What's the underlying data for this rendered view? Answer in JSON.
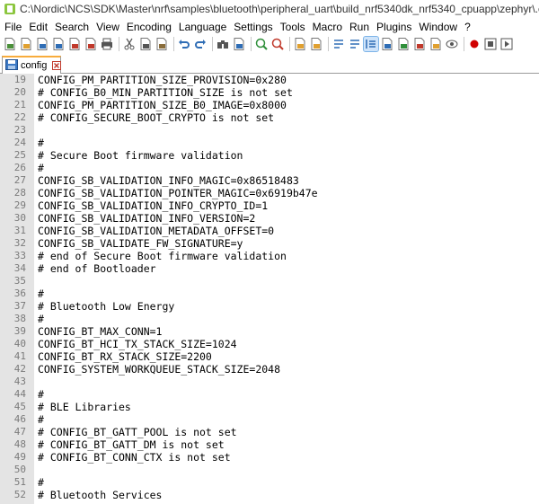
{
  "window": {
    "title": "C:\\Nordic\\NCS\\SDK\\Master\\nrf\\samples\\bluetooth\\peripheral_uart\\build_nrf5340dk_nrf5340_cpuapp\\zephyr\\.config -"
  },
  "menu": [
    {
      "name": "menu-file",
      "label": "File"
    },
    {
      "name": "menu-edit",
      "label": "Edit"
    },
    {
      "name": "menu-search",
      "label": "Search"
    },
    {
      "name": "menu-view",
      "label": "View"
    },
    {
      "name": "menu-encoding",
      "label": "Encoding"
    },
    {
      "name": "menu-language",
      "label": "Language"
    },
    {
      "name": "menu-settings",
      "label": "Settings"
    },
    {
      "name": "menu-tools",
      "label": "Tools"
    },
    {
      "name": "menu-macro",
      "label": "Macro"
    },
    {
      "name": "menu-run",
      "label": "Run"
    },
    {
      "name": "menu-plugins",
      "label": "Plugins"
    },
    {
      "name": "menu-window",
      "label": "Window"
    },
    {
      "name": "menu-help",
      "label": "?"
    }
  ],
  "toolbar": [
    {
      "name": "new-file-icon",
      "color": "#4a8f3a"
    },
    {
      "name": "open-file-icon",
      "color": "#e0a030"
    },
    {
      "name": "save-icon",
      "color": "#2f6db5"
    },
    {
      "name": "save-all-icon",
      "color": "#2f6db5"
    },
    {
      "name": "close-file-icon",
      "color": "#c0392b"
    },
    {
      "name": "close-all-icon",
      "color": "#c0392b"
    },
    {
      "name": "print-icon",
      "color": "#555555"
    },
    {
      "sep": true
    },
    {
      "name": "cut-icon",
      "color": "#555555"
    },
    {
      "name": "copy-icon",
      "color": "#555555"
    },
    {
      "name": "paste-icon",
      "color": "#8a6d3b"
    },
    {
      "sep": true
    },
    {
      "name": "undo-icon",
      "color": "#2f6db5"
    },
    {
      "name": "redo-icon",
      "color": "#2f6db5"
    },
    {
      "sep": true
    },
    {
      "name": "find-icon",
      "color": "#555555"
    },
    {
      "name": "replace-icon",
      "color": "#2f6db5"
    },
    {
      "sep": true
    },
    {
      "name": "zoom-in-icon",
      "color": "#2f8f3a"
    },
    {
      "name": "zoom-out-icon",
      "color": "#c0392b"
    },
    {
      "sep": true
    },
    {
      "name": "sync-vertical-icon",
      "color": "#e0a030"
    },
    {
      "name": "sync-horizontal-icon",
      "color": "#e0a030"
    },
    {
      "sep": true
    },
    {
      "name": "word-wrap-icon",
      "color": "#2f6db5"
    },
    {
      "name": "show-all-chars-icon",
      "color": "#2f6db5"
    },
    {
      "name": "indent-guide-icon",
      "color": "#2f6db5",
      "active": true
    },
    {
      "name": "user-language-icon",
      "color": "#2f6db5"
    },
    {
      "name": "document-map-icon",
      "color": "#2f8f3a"
    },
    {
      "name": "function-list-icon",
      "color": "#c0392b"
    },
    {
      "name": "folder-workspace-icon",
      "color": "#e0a030"
    },
    {
      "name": "monitoring-icon",
      "color": "#555555"
    },
    {
      "sep": true
    },
    {
      "name": "record-macro-icon",
      "color": "#d00000"
    },
    {
      "name": "stop-macro-icon",
      "color": "#555555"
    },
    {
      "name": "play-macro-icon",
      "color": "#555555"
    }
  ],
  "tab": {
    "label": "config",
    "color": "#f8ac3c"
  },
  "lines": [
    {
      "n": "19",
      "text": "CONFIG_PM_PARTITION_SIZE_PROVISION=0x280"
    },
    {
      "n": "20",
      "text": "# CONFIG_B0_MIN_PARTITION_SIZE is not set"
    },
    {
      "n": "21",
      "text": "CONFIG_PM_PARTITION_SIZE_B0_IMAGE=0x8000"
    },
    {
      "n": "22",
      "text": "# CONFIG_SECURE_BOOT_CRYPTO is not set"
    },
    {
      "n": "23",
      "text": ""
    },
    {
      "n": "24",
      "text": "#"
    },
    {
      "n": "25",
      "text": "# Secure Boot firmware validation"
    },
    {
      "n": "26",
      "text": "#"
    },
    {
      "n": "27",
      "text": "CONFIG_SB_VALIDATION_INFO_MAGIC=0x86518483"
    },
    {
      "n": "28",
      "text": "CONFIG_SB_VALIDATION_POINTER_MAGIC=0x6919b47e"
    },
    {
      "n": "29",
      "text": "CONFIG_SB_VALIDATION_INFO_CRYPTO_ID=1"
    },
    {
      "n": "30",
      "text": "CONFIG_SB_VALIDATION_INFO_VERSION=2"
    },
    {
      "n": "31",
      "text": "CONFIG_SB_VALIDATION_METADATA_OFFSET=0"
    },
    {
      "n": "32",
      "text": "CONFIG_SB_VALIDATE_FW_SIGNATURE=y"
    },
    {
      "n": "33",
      "text": "# end of Secure Boot firmware validation"
    },
    {
      "n": "34",
      "text": "# end of Bootloader"
    },
    {
      "n": "35",
      "text": ""
    },
    {
      "n": "36",
      "text": "#"
    },
    {
      "n": "37",
      "text": "# Bluetooth Low Energy"
    },
    {
      "n": "38",
      "text": "#"
    },
    {
      "n": "39",
      "text": "CONFIG_BT_MAX_CONN=1"
    },
    {
      "n": "40",
      "text": "CONFIG_BT_HCI_TX_STACK_SIZE=1024"
    },
    {
      "n": "41",
      "text": "CONFIG_BT_RX_STACK_SIZE=2200"
    },
    {
      "n": "42",
      "text": "CONFIG_SYSTEM_WORKQUEUE_STACK_SIZE=2048"
    },
    {
      "n": "43",
      "text": ""
    },
    {
      "n": "44",
      "text": "#"
    },
    {
      "n": "45",
      "text": "# BLE Libraries"
    },
    {
      "n": "46",
      "text": "#"
    },
    {
      "n": "47",
      "text": "# CONFIG_BT_GATT_POOL is not set"
    },
    {
      "n": "48",
      "text": "# CONFIG_BT_GATT_DM is not set"
    },
    {
      "n": "49",
      "text": "# CONFIG_BT_CONN_CTX is not set"
    },
    {
      "n": "50",
      "text": ""
    },
    {
      "n": "51",
      "text": "#"
    },
    {
      "n": "52",
      "text": "# Bluetooth Services"
    }
  ]
}
